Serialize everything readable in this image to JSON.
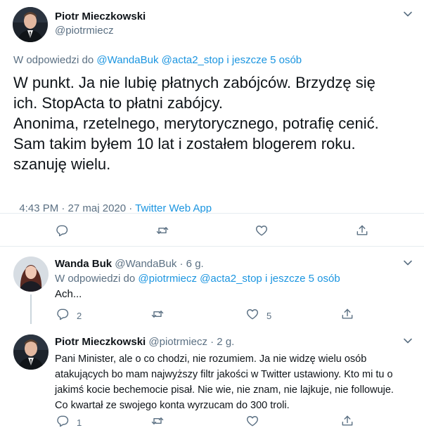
{
  "main_tweet": {
    "display_name": "Piotr Mieczkowski",
    "handle": "@piotrmiecz",
    "reply_prefix": "W odpowiedzi do",
    "reply_mentions": "@WandaBuk @acta2_stop",
    "reply_others": "i jeszcze 5 osób",
    "text_lines": [
      "W punkt. Ja nie lubię płatnych zabójców. Brzydzę się",
      "ich.  StopActa to płatni zabójcy.",
      "Anonima, rzetelnego, merytorycznego, potrafię cenić.",
      "Sam takim byłem 10 lat i zostałem blogerem roku.",
      "szanuję wielu."
    ],
    "timestamp": "4:43 PM · 27 maj 2020 · ",
    "source": "Twitter Web App"
  },
  "reply1": {
    "display_name": "Wanda Buk",
    "handle": "@WandaBuk",
    "age": "· 6 g.",
    "reply_prefix": "W odpowiedzi do",
    "reply_mentions": "@piotrmiecz @acta2_stop",
    "reply_others": "i jeszcze 5 osób",
    "text": "Ach...",
    "reply_count": "2",
    "like_count": "5"
  },
  "reply2": {
    "display_name": "Piotr Mieczkowski",
    "handle": "@piotrmiecz",
    "age": "· 2 g.",
    "text_lines": [
      "Pani Minister, ale o co chodzi, nie rozumiem. Ja nie widzę wielu osób",
      "atakujących bo mam najwyższy filtr jakości w  Twitter ustawiony. Kto mi tu o",
      "jakimś kocie bechemocie pisał. Nie wie, nie znam, nie lajkuje, nie followuje.",
      "Co kwartał ze swojego konta wyrzucam do 300 troli."
    ],
    "reply_count": "1"
  },
  "icons": {
    "reply": "reply-icon",
    "retweet": "retweet-icon",
    "like": "like-icon",
    "share": "share-icon",
    "more": "chevron-down-icon"
  },
  "colors": {
    "link": "#1b95e0",
    "muted": "#5b7083",
    "icon": "#5b7083",
    "divider": "#e6ecf0"
  }
}
